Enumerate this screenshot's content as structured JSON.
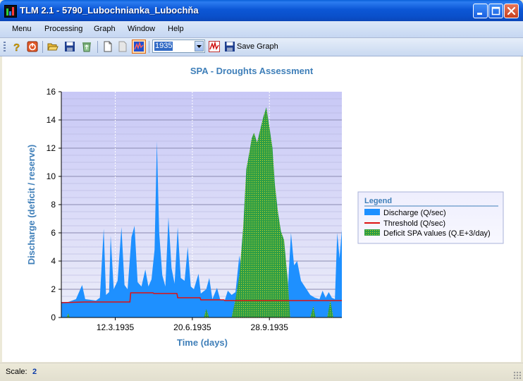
{
  "window": {
    "title": "TLM 2.1 - 5790_Lubochnianka_Lubochňa"
  },
  "menubar": {
    "items": [
      "Menu",
      "Processing",
      "Graph",
      "Window",
      "Help"
    ]
  },
  "toolbar": {
    "icons": [
      "help-icon",
      "exit-icon",
      "open-folder-icon",
      "save-icon",
      "recycle-icon",
      "new-document-icon",
      "document-icon",
      "graph-icon"
    ],
    "year_value": "1935",
    "save_graph_label": "Save Graph"
  },
  "status": {
    "label": "Scale:",
    "value": "2"
  },
  "colors": {
    "discharge": "#1e90ff",
    "threshold": "#dd1111",
    "deficit": "#2e9e46",
    "plot_background": "#ccccf7",
    "title": "#3f7fb9"
  },
  "chart_data": {
    "type": "area",
    "title": "SPA - Droughts Assessment",
    "xlabel": "Time (days)",
    "ylabel": "Discharge (deficit / reserve)",
    "ylim": [
      0,
      16
    ],
    "yticks": [
      0,
      2,
      4,
      6,
      8,
      10,
      12,
      14,
      16
    ],
    "xlim": [
      "1935-01-01",
      "1935-12-31"
    ],
    "xticks": [
      "12.3.1935",
      "20.6.1935",
      "28.9.1935"
    ],
    "grid": true,
    "legend": {
      "title": "Legend",
      "position": "right",
      "entries": [
        "Discharge (Q/sec)",
        "Threshold (Q/sec)",
        "Deficit SPA values (Q.E+3/day)"
      ]
    },
    "series": [
      {
        "name": "Discharge (Q/sec)",
        "style": "area",
        "points": [
          [
            "1935-01-01",
            1.1
          ],
          [
            "1935-01-10",
            1.1
          ],
          [
            "1935-01-20",
            1.3
          ],
          [
            "1935-01-28",
            2.3
          ],
          [
            "1935-02-01",
            1.3
          ],
          [
            "1935-02-15",
            1.2
          ],
          [
            "1935-02-20",
            1.4
          ],
          [
            "1935-02-25",
            6.3
          ],
          [
            "1935-02-28",
            1.6
          ],
          [
            "1935-03-04",
            1.8
          ],
          [
            "1935-03-06",
            5.8
          ],
          [
            "1935-03-10",
            2.0
          ],
          [
            "1935-03-15",
            2.6
          ],
          [
            "1935-03-20",
            6.4
          ],
          [
            "1935-03-24",
            2.3
          ],
          [
            "1935-03-28",
            2.0
          ],
          [
            "1935-04-02",
            5.7
          ],
          [
            "1935-04-06",
            6.5
          ],
          [
            "1935-04-10",
            2.5
          ],
          [
            "1935-04-15",
            2.2
          ],
          [
            "1935-04-20",
            3.4
          ],
          [
            "1935-04-24",
            2.2
          ],
          [
            "1935-04-28",
            2.7
          ],
          [
            "1935-05-02",
            4.8
          ],
          [
            "1935-05-05",
            12.5
          ],
          [
            "1935-05-08",
            6.0
          ],
          [
            "1935-05-12",
            3.0
          ],
          [
            "1935-05-16",
            2.2
          ],
          [
            "1935-05-20",
            7.1
          ],
          [
            "1935-05-24",
            3.5
          ],
          [
            "1935-05-28",
            2.4
          ],
          [
            "1935-06-01",
            6.4
          ],
          [
            "1935-06-05",
            2.8
          ],
          [
            "1935-06-10",
            2.6
          ],
          [
            "1935-06-14",
            5.0
          ],
          [
            "1935-06-18",
            2.2
          ],
          [
            "1935-06-22",
            2.0
          ],
          [
            "1935-06-28",
            3.1
          ],
          [
            "1935-07-01",
            1.7
          ],
          [
            "1935-07-08",
            2.0
          ],
          [
            "1935-07-12",
            2.8
          ],
          [
            "1935-07-16",
            1.3
          ],
          [
            "1935-07-22",
            2.1
          ],
          [
            "1935-07-26",
            1.3
          ],
          [
            "1935-08-01",
            1.2
          ],
          [
            "1935-08-05",
            1.9
          ],
          [
            "1935-08-10",
            1.6
          ],
          [
            "1935-08-15",
            1.8
          ],
          [
            "1935-08-20",
            4.4
          ],
          [
            "1935-08-24",
            2.5
          ],
          [
            "1935-08-28",
            3.3
          ],
          [
            "1935-09-01",
            2.3
          ],
          [
            "1935-09-05",
            1.7
          ],
          [
            "1935-09-10",
            1.8
          ],
          [
            "1935-09-15",
            2.4
          ],
          [
            "1935-09-20",
            1.4
          ],
          [
            "1935-09-25",
            1.8
          ],
          [
            "1935-10-01",
            2.0
          ],
          [
            "1935-10-05",
            2.2
          ],
          [
            "1935-10-10",
            3.5
          ],
          [
            "1935-10-14",
            2.2
          ],
          [
            "1935-10-18",
            2.8
          ],
          [
            "1935-10-22",
            2.1
          ],
          [
            "1935-10-26",
            6.0
          ],
          [
            "1935-10-30",
            3.7
          ],
          [
            "1935-11-03",
            4.0
          ],
          [
            "1935-11-08",
            2.6
          ],
          [
            "1935-11-14",
            2.1
          ],
          [
            "1935-11-20",
            1.6
          ],
          [
            "1935-11-26",
            1.4
          ],
          [
            "1935-12-02",
            1.3
          ],
          [
            "1935-12-06",
            1.9
          ],
          [
            "1935-12-10",
            1.4
          ],
          [
            "1935-12-14",
            1.8
          ],
          [
            "1935-12-18",
            1.4
          ],
          [
            "1935-12-22",
            1.3
          ],
          [
            "1935-12-25",
            6.0
          ],
          [
            "1935-12-28",
            4.2
          ],
          [
            "1935-12-31",
            6.2
          ]
        ]
      },
      {
        "name": "Threshold (Q/sec)",
        "style": "line",
        "points": [
          [
            "1935-01-01",
            1.05
          ],
          [
            "1935-01-31",
            1.1
          ],
          [
            "1935-03-31",
            1.1
          ],
          [
            "1935-04-01",
            1.75
          ],
          [
            "1935-04-30",
            1.75
          ],
          [
            "1935-05-01",
            1.7
          ],
          [
            "1935-05-31",
            1.7
          ],
          [
            "1935-06-01",
            1.4
          ],
          [
            "1935-06-30",
            1.4
          ],
          [
            "1935-07-01",
            1.25
          ],
          [
            "1935-07-31",
            1.25
          ],
          [
            "1935-08-01",
            1.2
          ],
          [
            "1935-12-31",
            1.2
          ]
        ]
      },
      {
        "name": "Deficit SPA values (Q.E+3/day)",
        "style": "area",
        "points": [
          [
            "1935-01-01",
            0
          ],
          [
            "1935-01-08",
            0
          ],
          [
            "1935-01-10",
            0.3
          ],
          [
            "1935-01-12",
            0
          ],
          [
            "1935-07-05",
            0
          ],
          [
            "1935-07-08",
            0.6
          ],
          [
            "1935-07-12",
            0
          ],
          [
            "1935-08-10",
            0
          ],
          [
            "1935-08-15",
            1.3
          ],
          [
            "1935-08-20",
            3.0
          ],
          [
            "1935-08-25",
            6.4
          ],
          [
            "1935-08-29",
            10.5
          ],
          [
            "1935-09-02",
            11.7
          ],
          [
            "1935-09-05",
            12.7
          ],
          [
            "1935-09-08",
            13.1
          ],
          [
            "1935-09-12",
            12.4
          ],
          [
            "1935-09-16",
            13.3
          ],
          [
            "1935-09-20",
            14.2
          ],
          [
            "1935-09-24",
            14.9
          ],
          [
            "1935-09-28",
            13.5
          ],
          [
            "1935-10-02",
            12.0
          ],
          [
            "1935-10-05",
            9.5
          ],
          [
            "1935-10-09",
            7.5
          ],
          [
            "1935-10-13",
            6.1
          ],
          [
            "1935-10-17",
            5.5
          ],
          [
            "1935-10-22",
            2.5
          ],
          [
            "1935-10-25",
            0
          ],
          [
            "1935-11-20",
            0
          ],
          [
            "1935-11-24",
            0.8
          ],
          [
            "1935-11-27",
            0
          ],
          [
            "1935-12-12",
            0
          ],
          [
            "1935-12-16",
            1.2
          ],
          [
            "1935-12-20",
            0
          ],
          [
            "1935-12-31",
            0
          ]
        ]
      }
    ]
  }
}
